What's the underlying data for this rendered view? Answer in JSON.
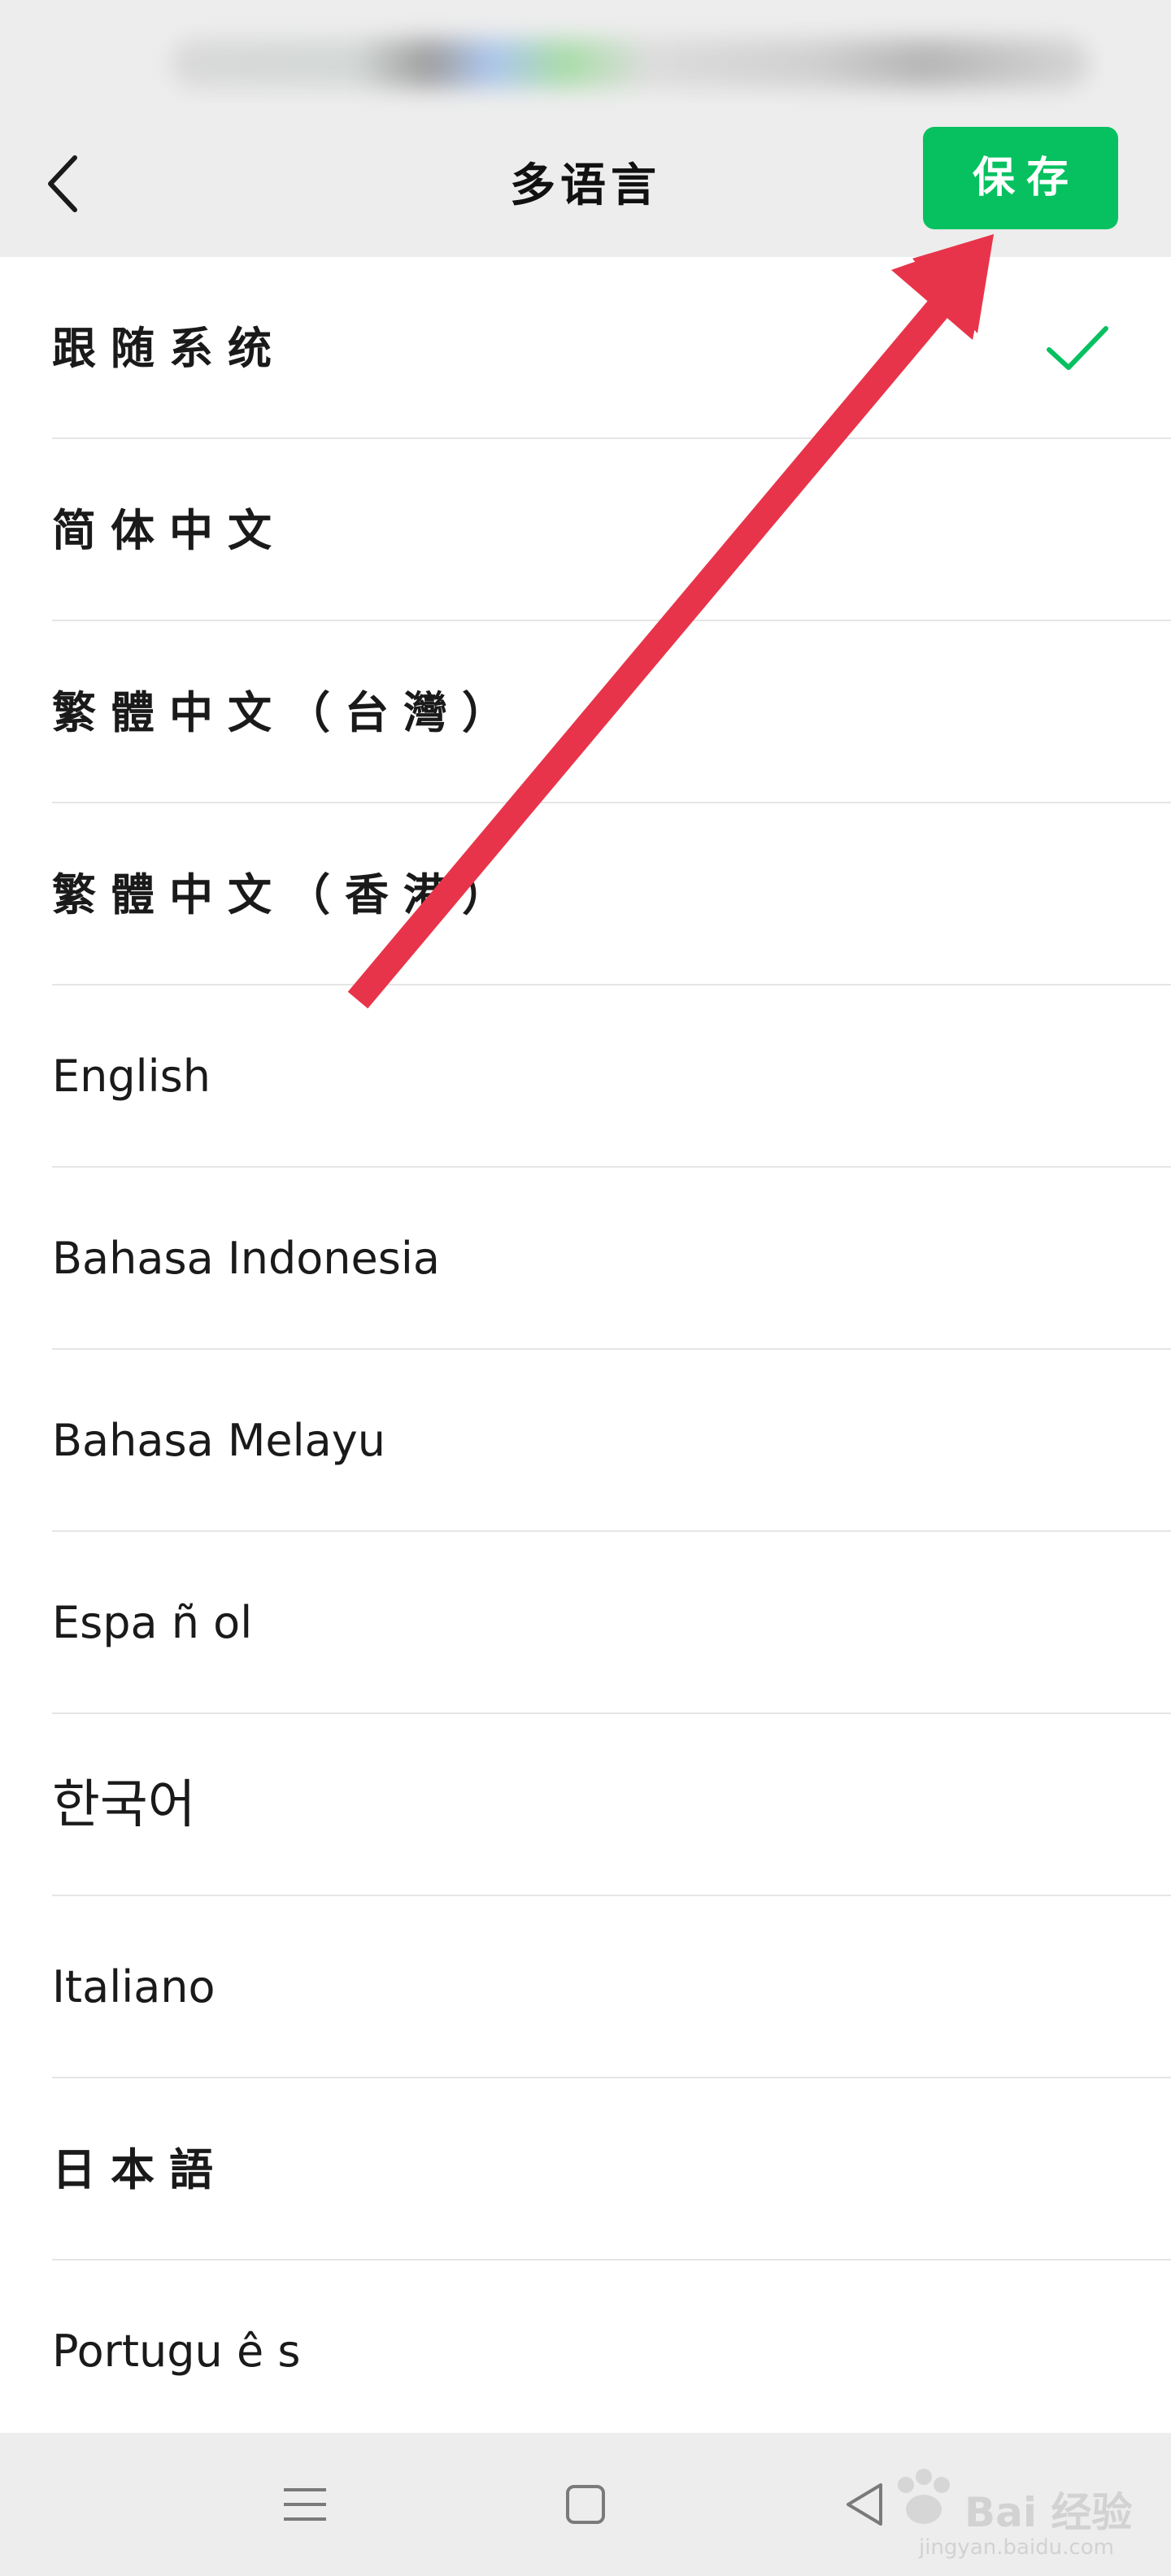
{
  "header": {
    "title": "多语言",
    "save_label": "保存"
  },
  "languages": [
    {
      "label": "跟随系统",
      "selected": true
    },
    {
      "label": "简体中文",
      "selected": false
    },
    {
      "label": "繁體中文（台灣）",
      "selected": false
    },
    {
      "label": "繁體中文（香港）",
      "selected": false
    },
    {
      "label": "English",
      "selected": false
    },
    {
      "label": "Bahasa Indonesia",
      "selected": false
    },
    {
      "label": "Bahasa Melayu",
      "selected": false
    },
    {
      "label": "Espa ñ ol",
      "selected": false
    },
    {
      "label": "한국어",
      "selected": false
    },
    {
      "label": "Italiano",
      "selected": false
    },
    {
      "label": "日本語",
      "selected": false
    },
    {
      "label": "Portugu ê s",
      "selected": false
    }
  ],
  "watermark": {
    "brand": "Bai 经验",
    "url": "jingyan.baidu.com"
  },
  "colors": {
    "accent_green": "#07c160",
    "annotation_red": "#e8344a",
    "background": "#ededed"
  },
  "icons": {
    "back": "chevron-left-icon",
    "check": "check-icon",
    "menu": "menu-icon",
    "home": "home-square-icon",
    "back_nav": "triangle-back-icon"
  }
}
